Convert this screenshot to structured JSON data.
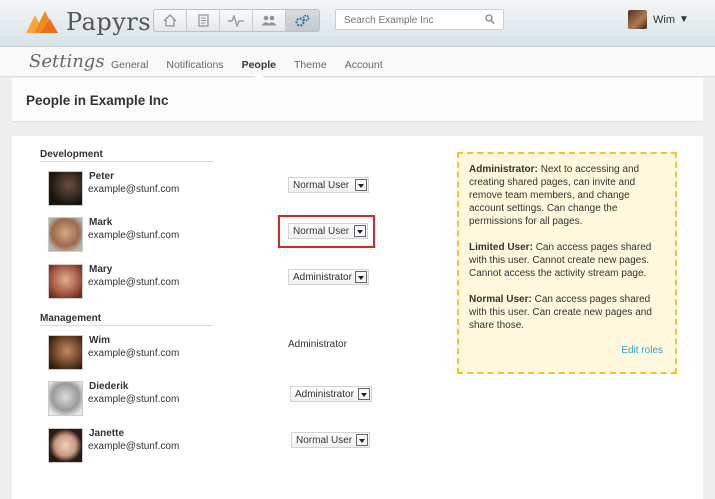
{
  "app": {
    "name": "Papyrs"
  },
  "search": {
    "placeholder": "Search Example Inc"
  },
  "user": {
    "name": "Wim",
    "caret": "▼"
  },
  "nav_icons": [
    "home-icon",
    "document-icon",
    "activity-icon",
    "people-icon",
    "settings-icon"
  ],
  "settings": {
    "title": "Settings",
    "tabs": [
      "General",
      "Notifications",
      "People",
      "Theme",
      "Account"
    ],
    "active_tab": "People"
  },
  "page": {
    "title": "People in Example Inc"
  },
  "groups": [
    {
      "name": "Development",
      "people": [
        {
          "name": "Peter",
          "email": "example@stunf.com",
          "role": "Normal User"
        },
        {
          "name": "Mark",
          "email": "example@stunf.com",
          "role": "Normal User"
        },
        {
          "name": "Mary",
          "email": "example@stunf.com",
          "role": "Administrator"
        }
      ]
    },
    {
      "name": "Management",
      "people": [
        {
          "name": "Wim",
          "email": "example@stunf.com",
          "role": "Administrator"
        },
        {
          "name": "Diederik",
          "email": "example@stunf.com",
          "role": "Administrator"
        },
        {
          "name": "Janette",
          "email": "example@stunf.com",
          "role": "Normal User"
        }
      ]
    }
  ],
  "roles_info": {
    "administrator_title": "Administrator:",
    "administrator_text": "Next to accessing and creating shared pages, can invite and remove team members, and change account settings. Can change the permissions for all pages.",
    "limited_title": "Limited User:",
    "limited_text": "Can access pages shared with this user. Cannot create new pages. Cannot access the activity stream page.",
    "normal_title": "Normal User:",
    "normal_text": "Can access pages shared with this user. Can create new pages and share those.",
    "edit_link": "Edit roles"
  },
  "colors": {
    "accent": "#2aa6d4",
    "highlight": "#d9262b",
    "info_border": "#f2c33a",
    "logo_orange": "#f08a24"
  }
}
